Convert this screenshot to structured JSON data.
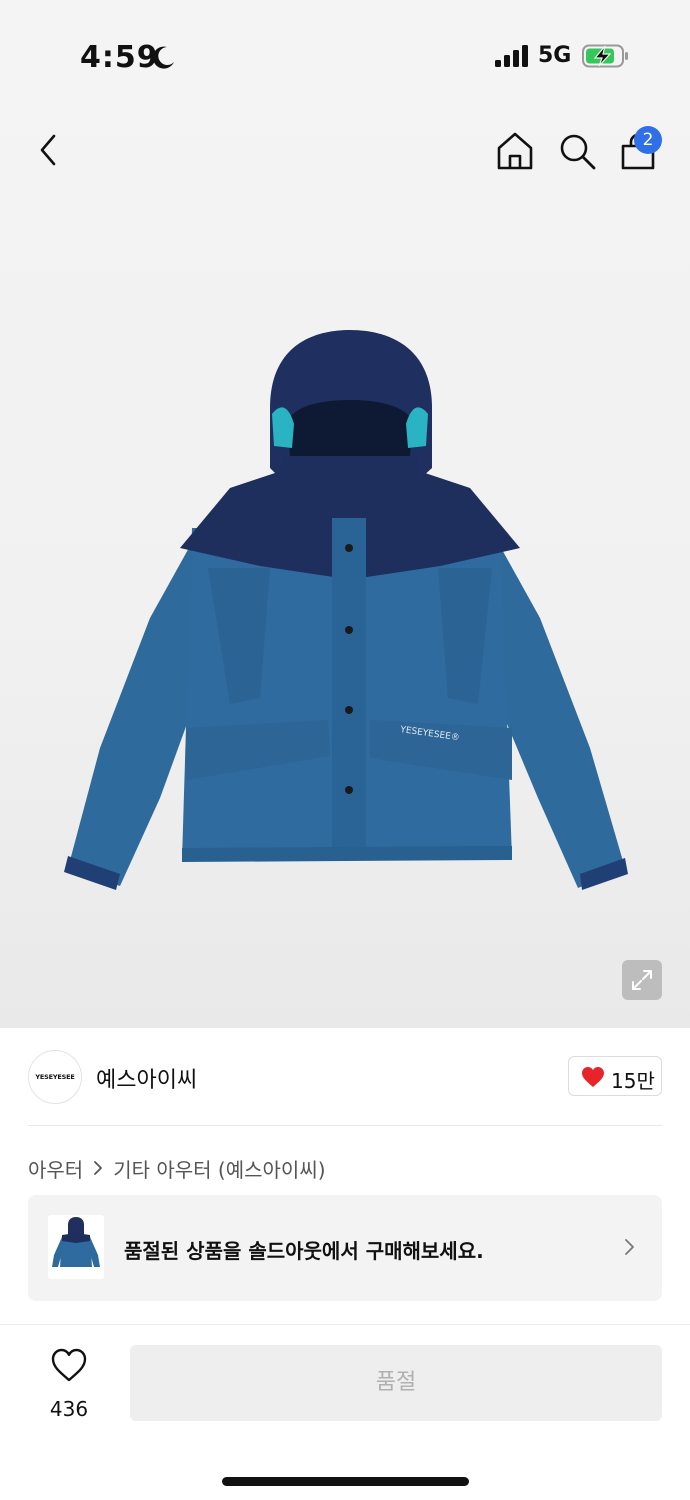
{
  "status_bar": {
    "time": "4:59",
    "network": "5G",
    "icons": [
      "moon-icon",
      "signal-icon",
      "battery-charging-icon"
    ]
  },
  "nav": {
    "icons": [
      "back-icon",
      "home-icon",
      "search-icon",
      "shopping-bag-icon"
    ],
    "cart_badge": "2",
    "badge_color": "#2f6fe8"
  },
  "product": {
    "image": "hooded-jacket-image",
    "image_logo_text": "YESEYESEE",
    "expand_icon": "expand-icon"
  },
  "brand": {
    "logo_text": "YESEYESEE",
    "name": "예스아이씨",
    "like_count": "15만",
    "heart_color": "#e8242b"
  },
  "breadcrumb": {
    "items": [
      "아우터",
      "기타 아우터 (예스아이씨)"
    ]
  },
  "soldout_banner": {
    "text": "품절된 상품을 솔드아웃에서 구매해보세요."
  },
  "bottom_bar": {
    "wish_count": "436",
    "action_label": "품절"
  }
}
